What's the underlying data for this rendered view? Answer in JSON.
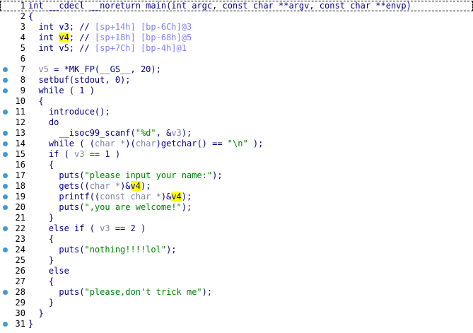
{
  "colors": {
    "background": "#ffffff",
    "code": "#000080",
    "comment": "#0000ff",
    "comment_offsets": "#8080ff",
    "string": "#008000",
    "highlight": "#ffff00",
    "breakpoint_dot": "#3f9ad6",
    "line_number": "#000000"
  },
  "lines": [
    {
      "num": "1",
      "dot": false,
      "segs": [
        {
          "t": "int __cdecl __noreturn main(int argc, const char **argv, const char **envp)",
          "c": "kw"
        }
      ]
    },
    {
      "num": "2",
      "dot": false,
      "segs": [
        {
          "t": "{",
          "c": "kw"
        }
      ]
    },
    {
      "num": "3",
      "dot": false,
      "segs": [
        {
          "t": "  int v3; // ",
          "c": "kw"
        },
        {
          "t": "[sp+14h] [bp-6Ch]@3",
          "c": "addr"
        }
      ]
    },
    {
      "num": "4",
      "dot": false,
      "segs": [
        {
          "t": "  int ",
          "c": "kw"
        },
        {
          "t": "v4",
          "c": "hl"
        },
        {
          "t": "; // ",
          "c": "kw"
        },
        {
          "t": "[sp+18h] [bp-68h]@5",
          "c": "addr"
        }
      ]
    },
    {
      "num": "5",
      "dot": false,
      "segs": [
        {
          "t": "  int v5; // ",
          "c": "kw"
        },
        {
          "t": "[sp+7Ch] [bp-4h]@1",
          "c": "addr"
        }
      ]
    },
    {
      "num": "6",
      "dot": false,
      "segs": [
        {
          "t": "",
          "c": "kw"
        }
      ]
    },
    {
      "num": "7",
      "dot": true,
      "segs": [
        {
          "t": "  ",
          "c": "kw"
        },
        {
          "t": "v5",
          "c": "vargray"
        },
        {
          "t": " = *MK_FP(__GS__, 20);",
          "c": "kw"
        }
      ]
    },
    {
      "num": "8",
      "dot": true,
      "segs": [
        {
          "t": "  setbuf(stdout, 0);",
          "c": "kw"
        }
      ]
    },
    {
      "num": "9",
      "dot": true,
      "segs": [
        {
          "t": "  while ( 1 )",
          "c": "kw"
        }
      ]
    },
    {
      "num": "10",
      "dot": false,
      "segs": [
        {
          "t": "  {",
          "c": "kw"
        }
      ]
    },
    {
      "num": "11",
      "dot": true,
      "segs": [
        {
          "t": "    introduce();",
          "c": "kw"
        }
      ]
    },
    {
      "num": "12",
      "dot": false,
      "segs": [
        {
          "t": "    do",
          "c": "kw"
        }
      ]
    },
    {
      "num": "13",
      "dot": true,
      "segs": [
        {
          "t": "      __isoc99_scanf(",
          "c": "kw"
        },
        {
          "t": "\"%d\"",
          "c": "str"
        },
        {
          "t": ", &",
          "c": "kw"
        },
        {
          "t": "v3",
          "c": "vargray"
        },
        {
          "t": ");",
          "c": "kw"
        }
      ]
    },
    {
      "num": "14",
      "dot": true,
      "segs": [
        {
          "t": "    while ( (",
          "c": "kw"
        },
        {
          "t": "char *",
          "c": "vargray"
        },
        {
          "t": ")(",
          "c": "kw"
        },
        {
          "t": "char",
          "c": "vargray"
        },
        {
          "t": ")getchar() == ",
          "c": "kw"
        },
        {
          "t": "\"\\n\"",
          "c": "str"
        },
        {
          "t": " );",
          "c": "kw"
        }
      ]
    },
    {
      "num": "15",
      "dot": true,
      "segs": [
        {
          "t": "    if ( ",
          "c": "kw"
        },
        {
          "t": "v3",
          "c": "vargray"
        },
        {
          "t": " == 1 )",
          "c": "kw"
        }
      ]
    },
    {
      "num": "16",
      "dot": false,
      "segs": [
        {
          "t": "    {",
          "c": "kw"
        }
      ]
    },
    {
      "num": "17",
      "dot": true,
      "segs": [
        {
          "t": "      puts(",
          "c": "kw"
        },
        {
          "t": "\"please input your name:\"",
          "c": "str"
        },
        {
          "t": ");",
          "c": "kw"
        }
      ]
    },
    {
      "num": "18",
      "dot": true,
      "segs": [
        {
          "t": "      gets((",
          "c": "kw"
        },
        {
          "t": "char *",
          "c": "vargray"
        },
        {
          "t": ")&",
          "c": "kw"
        },
        {
          "t": "v4",
          "c": "hl"
        },
        {
          "t": ");",
          "c": "kw"
        }
      ]
    },
    {
      "num": "19",
      "dot": true,
      "segs": [
        {
          "t": "      printf((",
          "c": "kw"
        },
        {
          "t": "const char *",
          "c": "vargray"
        },
        {
          "t": ")&",
          "c": "kw"
        },
        {
          "t": "v4",
          "c": "hl"
        },
        {
          "t": ");",
          "c": "kw"
        }
      ]
    },
    {
      "num": "20",
      "dot": true,
      "segs": [
        {
          "t": "      puts(",
          "c": "kw"
        },
        {
          "t": "\",you are welcome!\"",
          "c": "str"
        },
        {
          "t": ");",
          "c": "kw"
        }
      ]
    },
    {
      "num": "21",
      "dot": false,
      "segs": [
        {
          "t": "    }",
          "c": "kw"
        }
      ]
    },
    {
      "num": "22",
      "dot": true,
      "segs": [
        {
          "t": "    else if ( ",
          "c": "kw"
        },
        {
          "t": "v3",
          "c": "vargray"
        },
        {
          "t": " == 2 )",
          "c": "kw"
        }
      ]
    },
    {
      "num": "23",
      "dot": false,
      "segs": [
        {
          "t": "    {",
          "c": "kw"
        }
      ]
    },
    {
      "num": "24",
      "dot": true,
      "segs": [
        {
          "t": "      puts(",
          "c": "kw"
        },
        {
          "t": "\"nothing!!!!lol\"",
          "c": "str"
        },
        {
          "t": ");",
          "c": "kw"
        }
      ]
    },
    {
      "num": "25",
      "dot": false,
      "segs": [
        {
          "t": "    }",
          "c": "kw"
        }
      ]
    },
    {
      "num": "26",
      "dot": false,
      "segs": [
        {
          "t": "    else",
          "c": "kw"
        }
      ]
    },
    {
      "num": "27",
      "dot": false,
      "segs": [
        {
          "t": "    {",
          "c": "kw"
        }
      ]
    },
    {
      "num": "28",
      "dot": true,
      "segs": [
        {
          "t": "      puts(",
          "c": "kw"
        },
        {
          "t": "\"please,don't trick me\"",
          "c": "str"
        },
        {
          "t": ");",
          "c": "kw"
        }
      ]
    },
    {
      "num": "29",
      "dot": false,
      "segs": [
        {
          "t": "    }",
          "c": "kw"
        }
      ]
    },
    {
      "num": "30",
      "dot": false,
      "segs": [
        {
          "t": "  }",
          "c": "kw"
        }
      ]
    },
    {
      "num": "31",
      "dot": true,
      "segs": [
        {
          "t": "}",
          "c": "kw"
        }
      ]
    }
  ]
}
